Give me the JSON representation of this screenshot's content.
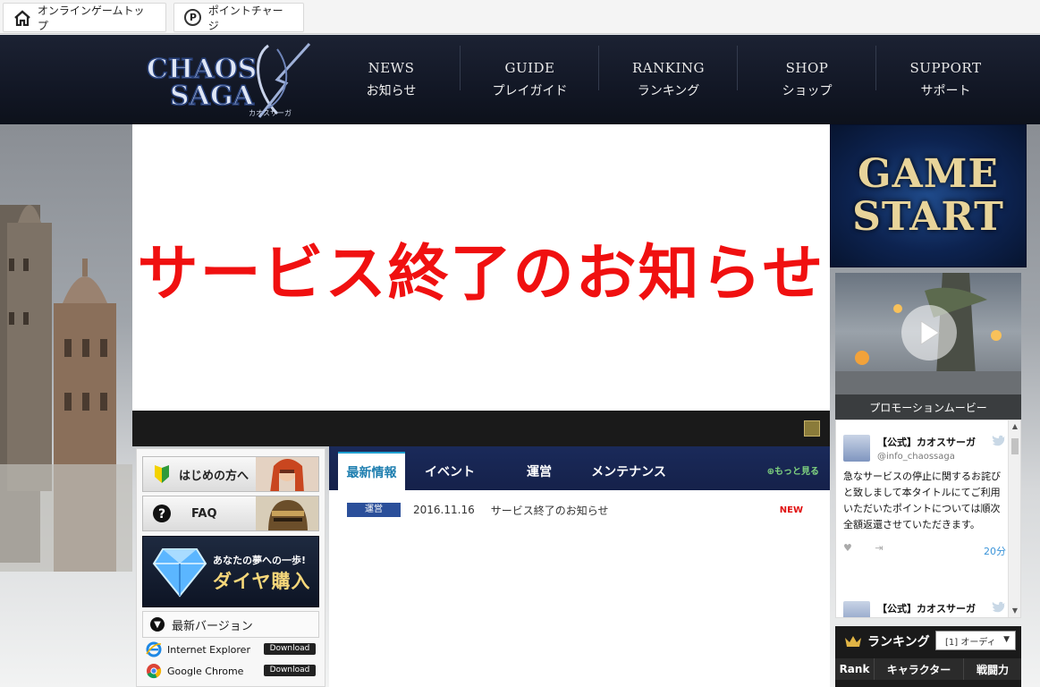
{
  "utilbar": {
    "home_label": "オンラインゲームトップ",
    "points_label": "ポイントチャージ",
    "points_glyph": "P"
  },
  "header": {
    "logo_line1": "CHAOS",
    "logo_line2": "SAGA",
    "logo_sub": "カオスサーガ",
    "nav": [
      {
        "en": "NEWS",
        "jp": "お知らせ"
      },
      {
        "en": "GUIDE",
        "jp": "プレイガイド"
      },
      {
        "en": "RANKING",
        "jp": "ランキング"
      },
      {
        "en": "SHOP",
        "jp": "ショップ"
      },
      {
        "en": "SUPPORT",
        "jp": "サポート"
      }
    ]
  },
  "banner": {
    "title": "サービス終了のお知らせ"
  },
  "left": {
    "beginner_label": "はじめの方へ",
    "faq_label": "FAQ",
    "dia_line1": "あなたの夢への一歩!",
    "dia_line2": "ダイヤ購入",
    "version_label": "最新バージョン",
    "browsers": [
      {
        "name": "Internet Explorer",
        "button": "Download"
      },
      {
        "name": "Google Chrome",
        "button": "Download"
      }
    ]
  },
  "news": {
    "tabs": [
      "最新情報",
      "イベント",
      "運営",
      "メンテナンス"
    ],
    "more_label": "もっと見る",
    "items": [
      {
        "category": "運営",
        "date": "2016.11.16",
        "title": "サービス終了のお知らせ",
        "badge": "NEW"
      }
    ]
  },
  "right": {
    "gamestart_line1": "GAME",
    "gamestart_line2": "START",
    "promo_caption": "プロモーションムービー",
    "tweets": [
      {
        "name": "【公式】カオスサーガ",
        "handle": "@info_chaossaga",
        "text": "急なサービスの停止に関するお詫びと致しまして本タイトルにてご利用いただいたポイントについては順次全額返還させていただきます。",
        "time": "20分"
      },
      {
        "name": "【公式】カオスサーガ"
      }
    ],
    "ranking": {
      "title": "ランキング",
      "select_value": "[1] オーディ",
      "columns": [
        "Rank",
        "キャラクター",
        "戦闘力"
      ]
    }
  },
  "colors": {
    "header_bg": "#121725",
    "banner_text": "#f01010",
    "news_tab_bg": "#1a2a5a",
    "new_badge": "#e01010",
    "category_badge": "#2b4f9a"
  }
}
